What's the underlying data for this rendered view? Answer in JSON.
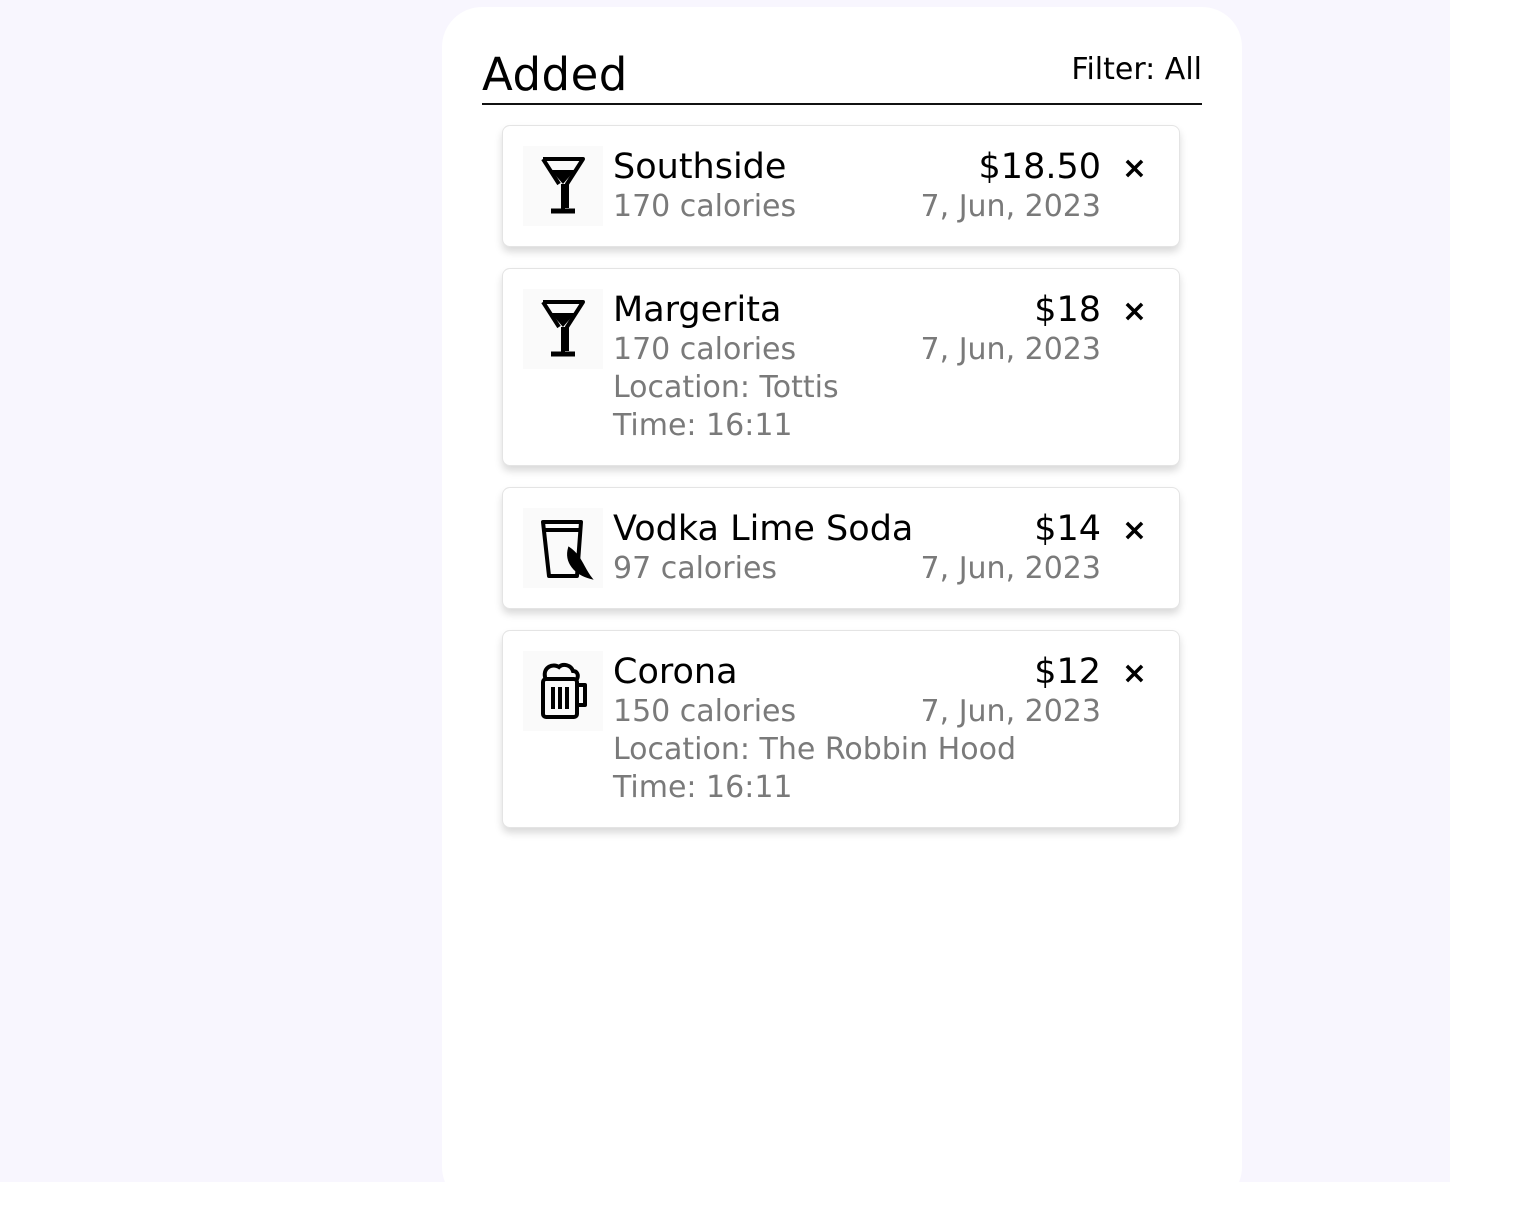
{
  "panel": {
    "title": "Added",
    "filter_label": "Filter: All"
  },
  "items": [
    {
      "icon": "cocktail-glass-icon",
      "name": "Southside",
      "price": "$18.50",
      "calories": "170 calories",
      "date": "7, Jun, 2023",
      "remove_label": "×"
    },
    {
      "icon": "cocktail-glass-icon",
      "name": "Margerita",
      "price": "$18",
      "calories": "170 calories",
      "date": "7, Jun, 2023",
      "location": "Location: Tottis",
      "time": "Time: 16:11",
      "remove_label": "×"
    },
    {
      "icon": "glass-with-lime-icon",
      "name": "Vodka Lime Soda",
      "price": "$14",
      "calories": "97 calories",
      "date": "7, Jun, 2023",
      "remove_label": "×"
    },
    {
      "icon": "beer-mug-icon",
      "name": "Corona",
      "price": "$12",
      "calories": "150 calories",
      "date": "7, Jun, 2023",
      "location": "Location: The Robbin Hood",
      "time": "Time: 16:11",
      "remove_label": "×"
    }
  ],
  "colors": {
    "page_background": "#f8f6fe",
    "panel_background": "#ffffff",
    "secondary_text": "#7a7a7a"
  }
}
